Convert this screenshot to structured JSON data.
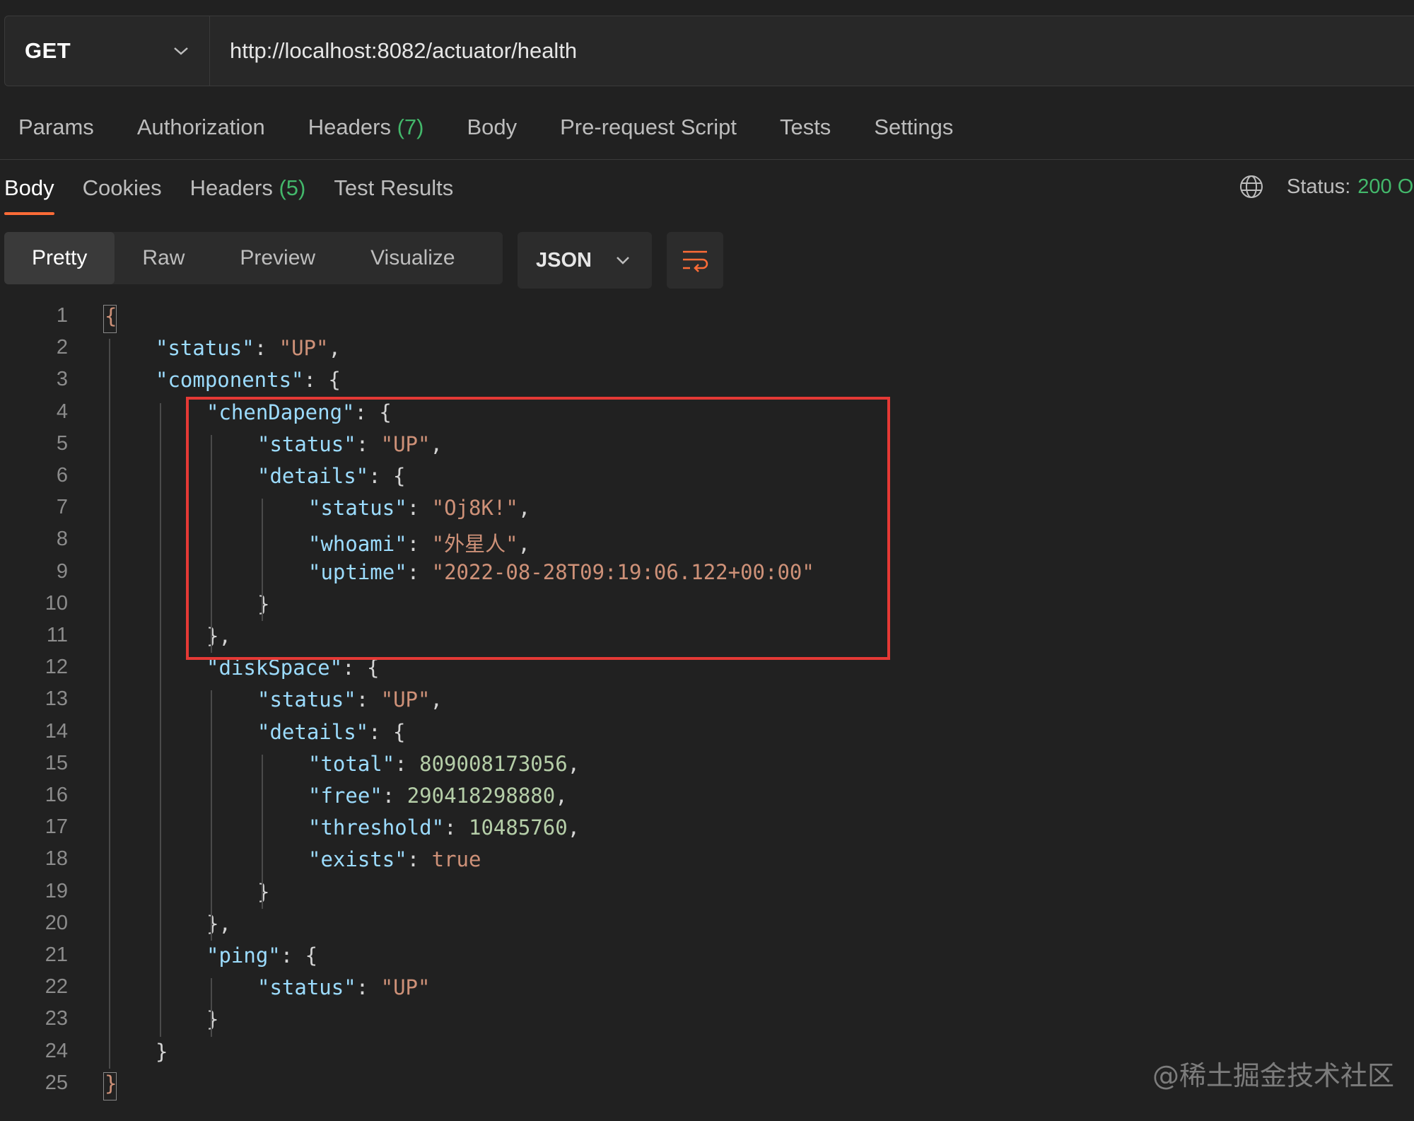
{
  "request": {
    "method": "GET",
    "url": "http://localhost:8082/actuator/health",
    "tabs": [
      {
        "label": "Params"
      },
      {
        "label": "Authorization"
      },
      {
        "label": "Headers ",
        "count": "(7)"
      },
      {
        "label": "Body"
      },
      {
        "label": "Pre-request Script"
      },
      {
        "label": "Tests"
      },
      {
        "label": "Settings"
      }
    ]
  },
  "response": {
    "tabs": [
      {
        "label": "Body",
        "active": true
      },
      {
        "label": "Cookies"
      },
      {
        "label": "Headers ",
        "count": "(5)"
      },
      {
        "label": "Test Results"
      }
    ],
    "status_label": "Status:",
    "status_value": "200 O",
    "views": [
      "Pretty",
      "Raw",
      "Preview",
      "Visualize"
    ],
    "active_view": "Pretty",
    "format": "JSON"
  },
  "code_lines": [
    {
      "n": "1",
      "indent": 0,
      "t": [
        [
          "b",
          "{"
        ]
      ]
    },
    {
      "n": "2",
      "indent": 1,
      "t": [
        [
          "k",
          "\"status\""
        ],
        [
          "p",
          ": "
        ],
        [
          "s",
          "\"UP\""
        ],
        [
          "p",
          ","
        ]
      ]
    },
    {
      "n": "3",
      "indent": 1,
      "t": [
        [
          "k",
          "\"components\""
        ],
        [
          "p",
          ": {"
        ]
      ]
    },
    {
      "n": "4",
      "indent": 2,
      "t": [
        [
          "k",
          "\"chenDapeng\""
        ],
        [
          "p",
          ": {"
        ]
      ]
    },
    {
      "n": "5",
      "indent": 3,
      "t": [
        [
          "k",
          "\"status\""
        ],
        [
          "p",
          ": "
        ],
        [
          "s",
          "\"UP\""
        ],
        [
          "p",
          ","
        ]
      ]
    },
    {
      "n": "6",
      "indent": 3,
      "t": [
        [
          "k",
          "\"details\""
        ],
        [
          "p",
          ": {"
        ]
      ]
    },
    {
      "n": "7",
      "indent": 4,
      "t": [
        [
          "k",
          "\"status\""
        ],
        [
          "p",
          ": "
        ],
        [
          "s",
          "\"Oj8K!\""
        ],
        [
          "p",
          ","
        ]
      ]
    },
    {
      "n": "8",
      "indent": 4,
      "t": [
        [
          "k",
          "\"whoami\""
        ],
        [
          "p",
          ": "
        ],
        [
          "s",
          "\"外星人\""
        ],
        [
          "p",
          ","
        ]
      ]
    },
    {
      "n": "9",
      "indent": 4,
      "t": [
        [
          "k",
          "\"uptime\""
        ],
        [
          "p",
          ": "
        ],
        [
          "s",
          "\"2022-08-28T09:19:06.122+00:00\""
        ]
      ]
    },
    {
      "n": "10",
      "indent": 3,
      "t": [
        [
          "p",
          "}"
        ]
      ]
    },
    {
      "n": "11",
      "indent": 2,
      "t": [
        [
          "p",
          "},"
        ]
      ]
    },
    {
      "n": "12",
      "indent": 2,
      "t": [
        [
          "k",
          "\"diskSpace\""
        ],
        [
          "p",
          ": {"
        ]
      ]
    },
    {
      "n": "13",
      "indent": 3,
      "t": [
        [
          "k",
          "\"status\""
        ],
        [
          "p",
          ": "
        ],
        [
          "s",
          "\"UP\""
        ],
        [
          "p",
          ","
        ]
      ]
    },
    {
      "n": "14",
      "indent": 3,
      "t": [
        [
          "k",
          "\"details\""
        ],
        [
          "p",
          ": {"
        ]
      ]
    },
    {
      "n": "15",
      "indent": 4,
      "t": [
        [
          "k",
          "\"total\""
        ],
        [
          "p",
          ": "
        ],
        [
          "n",
          "809008173056"
        ],
        [
          "p",
          ","
        ]
      ]
    },
    {
      "n": "16",
      "indent": 4,
      "t": [
        [
          "k",
          "\"free\""
        ],
        [
          "p",
          ": "
        ],
        [
          "n",
          "290418298880"
        ],
        [
          "p",
          ","
        ]
      ]
    },
    {
      "n": "17",
      "indent": 4,
      "t": [
        [
          "k",
          "\"threshold\""
        ],
        [
          "p",
          ": "
        ],
        [
          "n",
          "10485760"
        ],
        [
          "p",
          ","
        ]
      ]
    },
    {
      "n": "18",
      "indent": 4,
      "t": [
        [
          "k",
          "\"exists\""
        ],
        [
          "p",
          ": "
        ],
        [
          "s",
          "true"
        ]
      ]
    },
    {
      "n": "19",
      "indent": 3,
      "t": [
        [
          "p",
          "}"
        ]
      ]
    },
    {
      "n": "20",
      "indent": 2,
      "t": [
        [
          "p",
          "},"
        ]
      ]
    },
    {
      "n": "21",
      "indent": 2,
      "t": [
        [
          "k",
          "\"ping\""
        ],
        [
          "p",
          ": {"
        ]
      ]
    },
    {
      "n": "22",
      "indent": 3,
      "t": [
        [
          "k",
          "\"status\""
        ],
        [
          "p",
          ": "
        ],
        [
          "s",
          "\"UP\""
        ]
      ]
    },
    {
      "n": "23",
      "indent": 2,
      "t": [
        [
          "p",
          "}"
        ]
      ]
    },
    {
      "n": "24",
      "indent": 1,
      "t": [
        [
          "p",
          "}"
        ]
      ]
    },
    {
      "n": "25",
      "indent": 0,
      "t": [
        [
          "b",
          "}"
        ]
      ]
    }
  ],
  "watermark": "@稀土掘金技术社区"
}
